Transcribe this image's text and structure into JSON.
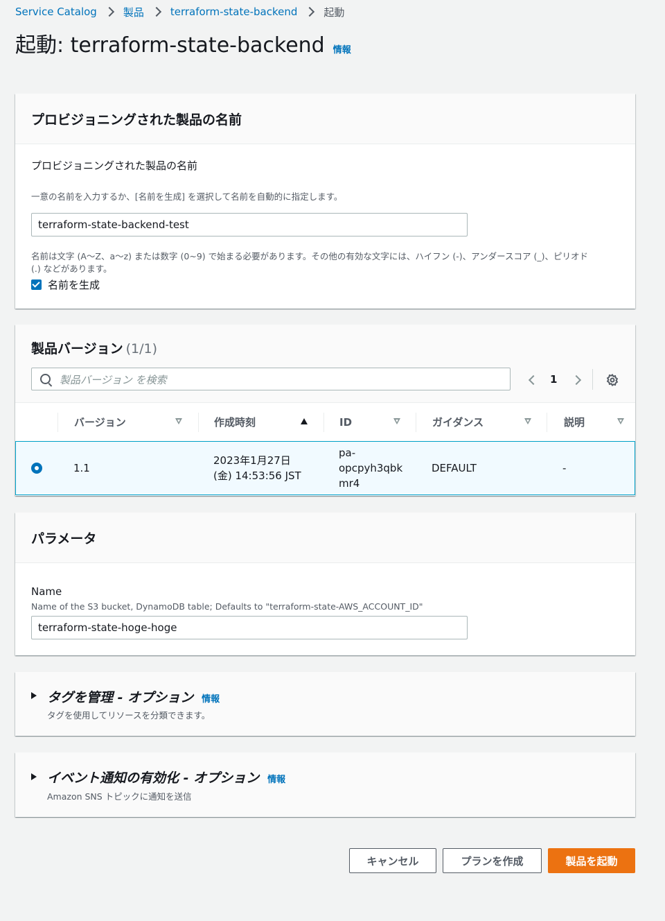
{
  "breadcrumb": {
    "items": [
      "Service Catalog",
      "製品",
      "terraform-state-backend"
    ],
    "current": "起動"
  },
  "page": {
    "title": "起動: terraform-state-backend",
    "info": "情報"
  },
  "name_panel": {
    "header": "プロビジョニングされた製品の名前",
    "label": "プロビジョニングされた製品の名前",
    "description": "一意の名前を入力するか、[名前を生成] を選択して名前を自動的に指定します。",
    "value": "terraform-state-backend-test",
    "constraint_line1": "名前は文字 (A〜Z、a〜z) または数字 (0~9) で始まる必要があります。その他の有効な文字には、ハイフン (-)、アンダースコア (_)、ピリオド",
    "constraint_line2": "(.) などがあります。",
    "generate_label": "名前を生成",
    "generate_checked": true
  },
  "version_panel": {
    "header": "製品バージョン",
    "count": "(1/1)",
    "search_placeholder": "製品バージョン を検索",
    "page": "1",
    "columns": [
      "バージョン",
      "作成時刻",
      "ID",
      "ガイダンス",
      "説明"
    ],
    "rows": [
      {
        "version": "1.1",
        "created_line1": "2023年1月27日",
        "created_line2": "(金) 14:53:56 JST",
        "id_line1": "pa-",
        "id_line2": "opcpyh3qbk",
        "id_line3": "mr4",
        "guidance": "DEFAULT",
        "description": "-",
        "selected": true
      }
    ]
  },
  "params_panel": {
    "header": "パラメータ",
    "name_label": "Name",
    "name_description": "Name of the S3 bucket, DynamoDB table; Defaults to \"terraform-state-AWS_ACCOUNT_ID\"",
    "name_value": "terraform-state-hoge-hoge"
  },
  "tags_panel": {
    "title": "タグを管理 - オプション",
    "info": "情報",
    "description": "タグを使用してリソースを分類できます。"
  },
  "events_panel": {
    "title": "イベント通知の有効化 - オプション",
    "info": "情報",
    "description": "Amazon SNS トピックに通知を送信"
  },
  "actions": {
    "cancel": "キャンセル",
    "plan": "プランを作成",
    "launch": "製品を起動"
  },
  "colors": {
    "link": "#0073bb",
    "primary": "#ec7211",
    "selected_row_bg": "#f1faff",
    "selected_row_border": "#00a1c9"
  }
}
